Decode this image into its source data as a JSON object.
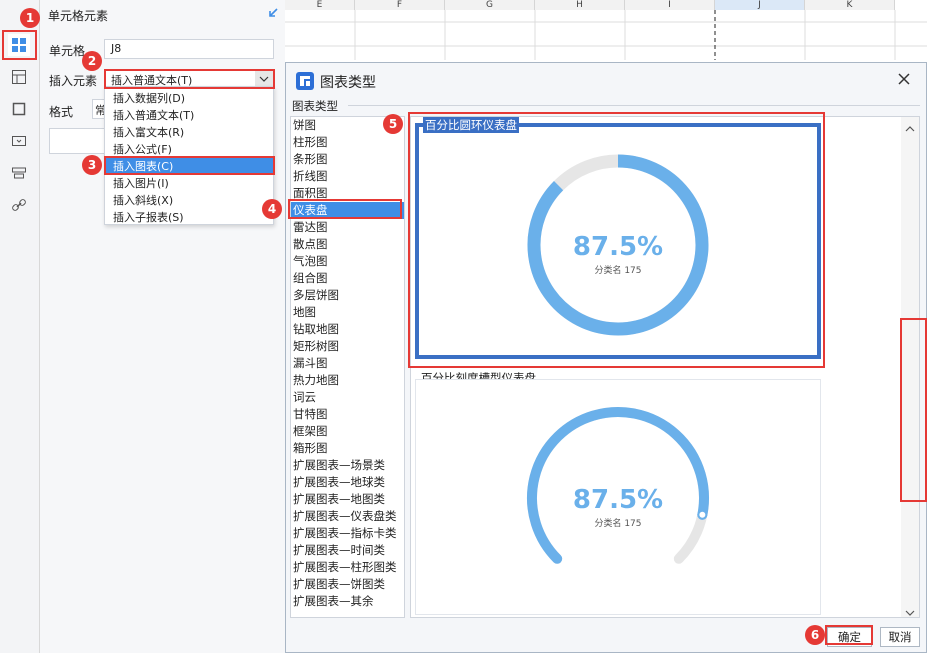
{
  "panel": {
    "title": "单元格元素",
    "cell_label": "单元格",
    "cell_value": "J8",
    "insert_label": "插入元素",
    "insert_value": "插入普通文本(T)",
    "format_label": "格式",
    "format_value": "常"
  },
  "dropdown_items": [
    "插入数据列(D)",
    "插入普通文本(T)",
    "插入富文本(R)",
    "插入公式(F)",
    "插入图表(C)",
    "插入图片(I)",
    "插入斜线(X)",
    "插入子报表(S)"
  ],
  "sheet": {
    "columns": [
      "E",
      "F",
      "G",
      "H",
      "I",
      "J",
      "K"
    ]
  },
  "dialog": {
    "title": "图表类型",
    "group_label": "图表类型",
    "types": [
      "饼图",
      "柱形图",
      "条形图",
      "折线图",
      "面积图",
      "仪表盘",
      "雷达图",
      "散点图",
      "气泡图",
      "组合图",
      "多层饼图",
      "地图",
      "钻取地图",
      "矩形树图",
      "漏斗图",
      "热力地图",
      "词云",
      "甘特图",
      "框架图",
      "箱形图",
      "扩展图表—场景类",
      "扩展图表—地球类",
      "扩展图表—地图类",
      "扩展图表—仪表盘类",
      "扩展图表—指标卡类",
      "扩展图表—时间类",
      "扩展图表—柱形图类",
      "扩展图表—饼图类",
      "扩展图表—其余"
    ],
    "selected_type": "仪表盘",
    "charts": [
      {
        "title": "百分比圆环仪表盘",
        "value": "87.5%",
        "sub": "分类名 175",
        "percent": 87.5
      },
      {
        "title": "百分比刻度槽型仪表盘",
        "value": "87.5%",
        "sub": "分类名 175",
        "percent": 87.5
      }
    ],
    "ok_label": "确定",
    "cancel_label": "取消"
  },
  "badges": [
    "1",
    "2",
    "3",
    "4",
    "5",
    "6"
  ],
  "colors": {
    "accent": "#3f8ee6",
    "gauge": "#6ab0ea",
    "track": "#e6e6e6",
    "highlight": "#e53935"
  }
}
